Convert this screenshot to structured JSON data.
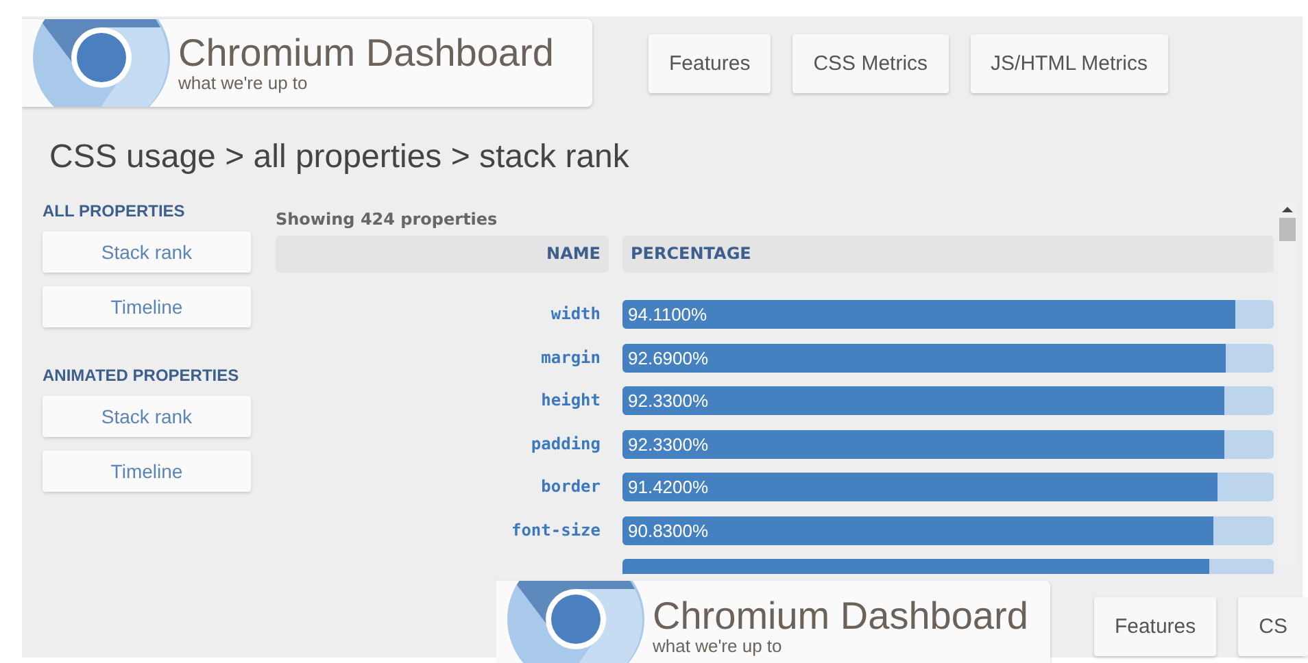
{
  "header": {
    "title": "Chromium Dashboard",
    "subtitle": "what we're up to"
  },
  "nav": [
    {
      "label": "Features"
    },
    {
      "label": "CSS Metrics"
    },
    {
      "label": "JS/HTML Metrics"
    }
  ],
  "breadcrumb": "CSS usage > all properties > stack rank",
  "sidebar": [
    {
      "heading": "ALL PROPERTIES",
      "items": [
        {
          "label": "Stack rank"
        },
        {
          "label": "Timeline"
        }
      ]
    },
    {
      "heading": "ANIMATED PROPERTIES",
      "items": [
        {
          "label": "Stack rank"
        },
        {
          "label": "Timeline"
        }
      ]
    }
  ],
  "table": {
    "summary": "Showing 424 properties",
    "columns": [
      "NAME",
      "PERCENTAGE"
    ],
    "rows": [
      {
        "name": "width",
        "value": "94.1100%",
        "level": 0.9411
      },
      {
        "name": "margin",
        "value": "92.6900%",
        "level": 0.9269
      },
      {
        "name": "height",
        "value": "92.3300%",
        "level": 0.9233
      },
      {
        "name": "padding",
        "value": "92.3300%",
        "level": 0.9233
      },
      {
        "name": "border",
        "value": "91.4200%",
        "level": 0.9142
      },
      {
        "name": "font-size",
        "value": "90.8300%",
        "level": 0.9083
      },
      {
        "level": 0.9
      }
    ]
  },
  "overlay_header": {
    "title": "Chromium Dashboard",
    "subtitle": "what we're up to",
    "nav": [
      {
        "label": "Features"
      },
      {
        "label": "CS"
      }
    ]
  }
}
